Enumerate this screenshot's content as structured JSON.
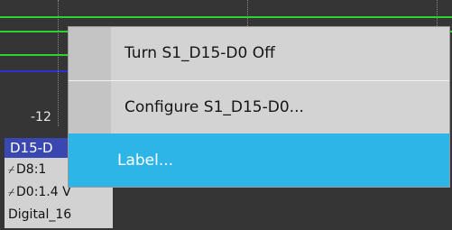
{
  "waveform": {
    "axis_value": "-12",
    "trace_colors": [
      "#2bd42b",
      "#2f2fd6"
    ]
  },
  "badge": {
    "title": "D15-D",
    "lines": [
      {
        "edge_icon": "rising-edge-icon",
        "text": "D8:1"
      },
      {
        "edge_icon": "rising-edge-icon",
        "text": "D0:1.4 V"
      },
      {
        "edge_icon": null,
        "text": "Digital_16"
      }
    ],
    "title_color": "#3a47b0"
  },
  "context_menu": {
    "items": [
      {
        "label": "Turn S1_D15-D0 Off",
        "highlighted": false
      },
      {
        "label": "Configure S1_D15-D0...",
        "highlighted": false
      },
      {
        "label": "Label...",
        "highlighted": true
      }
    ],
    "highlight_color": "#2db5e8"
  }
}
